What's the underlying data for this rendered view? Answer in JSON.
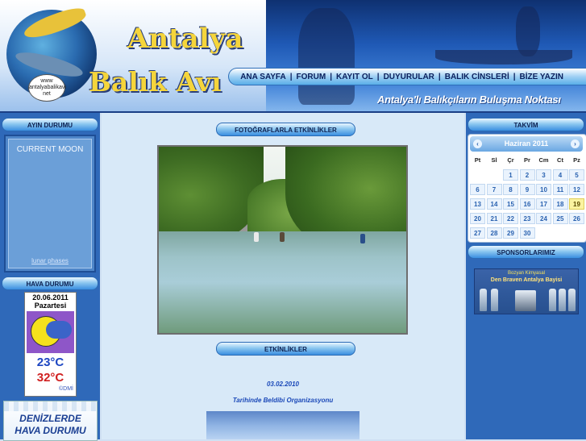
{
  "header": {
    "logo_badge": "www antalyabalikavi net",
    "title_line1": "Antalya",
    "title_line2": "Balık Avı",
    "tagline": "Antalya'lı Balıkçıların Buluşma Noktası",
    "nav": [
      "ANA SAYFA",
      "FORUM",
      "KAYIT OL",
      "DUYURULAR",
      "BALIK CİNSLERİ",
      "BİZE YAZIN"
    ],
    "nav_separator": "|"
  },
  "left": {
    "moon_panel_title": "AYIN DURUMU",
    "moon_text": "CURRENT MOON",
    "moon_link": "lunar phases",
    "weather_panel_title": "HAVA DURUMU",
    "weather": {
      "date": "20.06.2011",
      "day": "Pazartesi",
      "temp_low": "23°C",
      "temp_high": "32°C",
      "credit": "©DMİ",
      "icon": "partly-cloudy-icon"
    },
    "sea_banner": {
      "line1": "DENİZLERDE",
      "line2": "HAVA DURUMU"
    }
  },
  "center": {
    "photos_title": "FOTOĞRAFLARLA ETKİNLİKLER",
    "events_title": "ETKİNLİKLER",
    "event_date": "03.02.2010",
    "event_text": "Tarihinde Beldibi Organizasyonu"
  },
  "right": {
    "calendar_title": "TAKVİM",
    "calendar_month": "Haziran 2011",
    "prev": "‹",
    "next": "›",
    "weekdays": [
      "Pt",
      "Sl",
      "Çr",
      "Pr",
      "Cm",
      "Ct",
      "Pz"
    ],
    "weeks": [
      [
        "",
        "",
        "1",
        "2",
        "3",
        "4",
        "5"
      ],
      [
        "6",
        "7",
        "8",
        "9",
        "10",
        "11",
        "12"
      ],
      [
        "13",
        "14",
        "15",
        "16",
        "17",
        "18",
        "19"
      ],
      [
        "20",
        "21",
        "22",
        "23",
        "24",
        "25",
        "26"
      ],
      [
        "27",
        "28",
        "29",
        "30",
        "",
        "",
        ""
      ]
    ],
    "today": "19",
    "sponsors_title": "SPONSORLARIMIZ",
    "sponsor_line1": "Bozyan Kimyasal",
    "sponsor_line2": "Den Braven Antalya Bayisi"
  },
  "colors": {
    "page_bg": "#cfe0f3",
    "side_column": "#2f69b9",
    "title_gold": "#f5d53b",
    "link_blue": "#1a48b8"
  }
}
